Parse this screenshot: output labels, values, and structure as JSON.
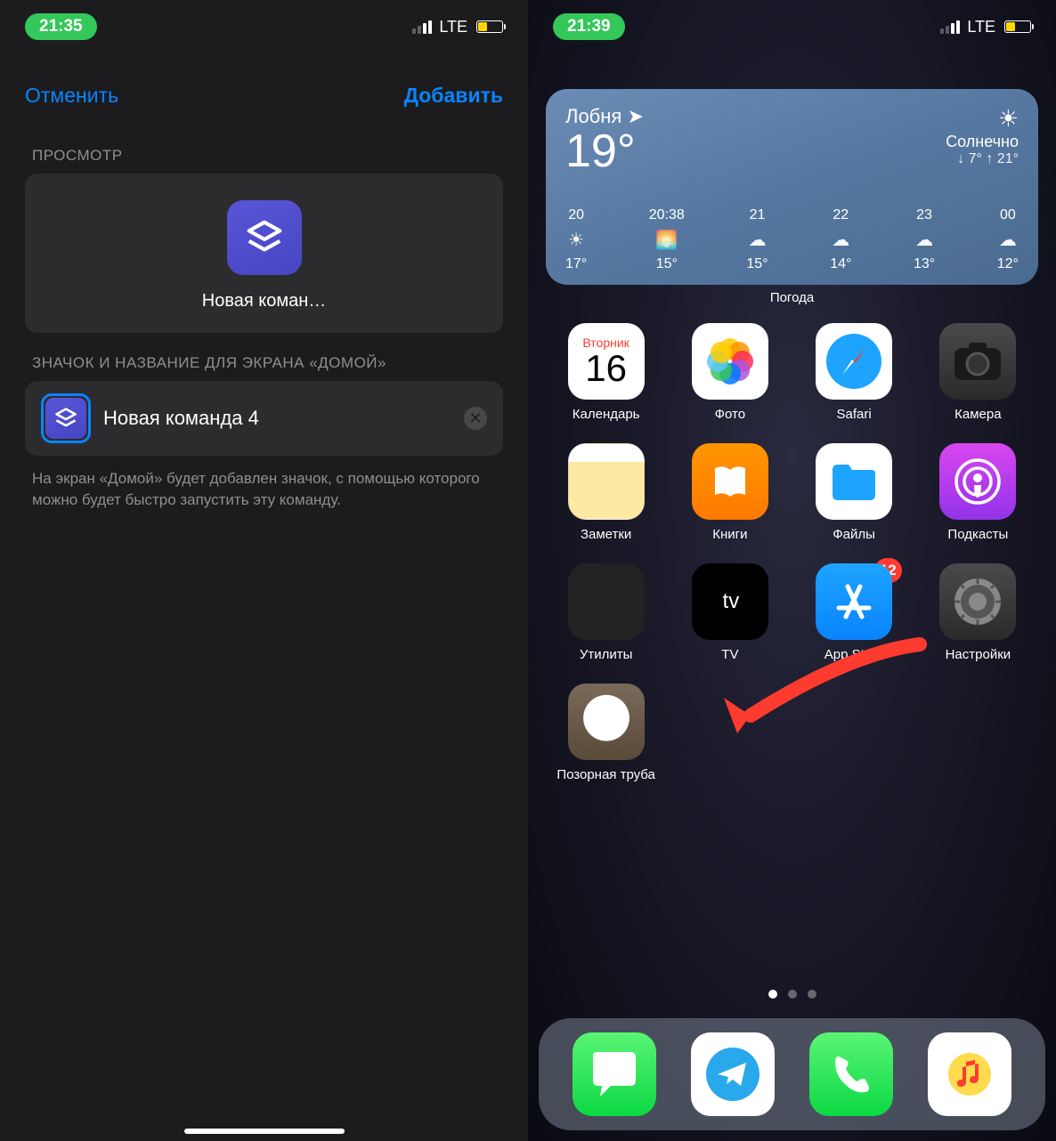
{
  "left": {
    "status": {
      "time": "21:35",
      "network": "LTE"
    },
    "nav": {
      "cancel": "Отменить",
      "add": "Добавить"
    },
    "preview_section": "ПРОСМОТР",
    "preview_name": "Новая коман…",
    "icon_section": "ЗНАЧОК И НАЗВАНИЕ ДЛЯ ЭКРАНА «ДОМОЙ»",
    "shortcut_name": "Новая команда 4",
    "hint": "На экран «Домой» будет добавлен значок, с помощью которого можно будет быстро запустить эту команду."
  },
  "right": {
    "status": {
      "time": "21:39",
      "network": "LTE"
    },
    "weather": {
      "city": "Лобня ➤",
      "temp": "19°",
      "cond": "Солнечно",
      "range": "↓ 7° ↑ 21°",
      "widget_label": "Погода",
      "hours": [
        {
          "h": "20",
          "icon": "☀",
          "t": "17°"
        },
        {
          "h": "20:38",
          "icon": "🌅",
          "t": "15°"
        },
        {
          "h": "21",
          "icon": "☁",
          "t": "15°"
        },
        {
          "h": "22",
          "icon": "☁",
          "t": "14°"
        },
        {
          "h": "23",
          "icon": "☁",
          "t": "13°"
        },
        {
          "h": "00",
          "icon": "☁",
          "t": "12°"
        }
      ]
    },
    "apps": {
      "calendar": {
        "label": "Календарь",
        "day": "Вторник",
        "date": "16"
      },
      "photos": {
        "label": "Фото"
      },
      "safari": {
        "label": "Safari"
      },
      "camera": {
        "label": "Камера"
      },
      "notes": {
        "label": "Заметки"
      },
      "books": {
        "label": "Книги"
      },
      "files": {
        "label": "Файлы"
      },
      "podcasts": {
        "label": "Подкасты"
      },
      "utilities": {
        "label": "Утилиты"
      },
      "tv": {
        "label": "TV"
      },
      "appstore": {
        "label": "App Store",
        "badge": "12"
      },
      "settings": {
        "label": "Настройки"
      },
      "custom": {
        "label": "Позорная труба"
      }
    }
  }
}
